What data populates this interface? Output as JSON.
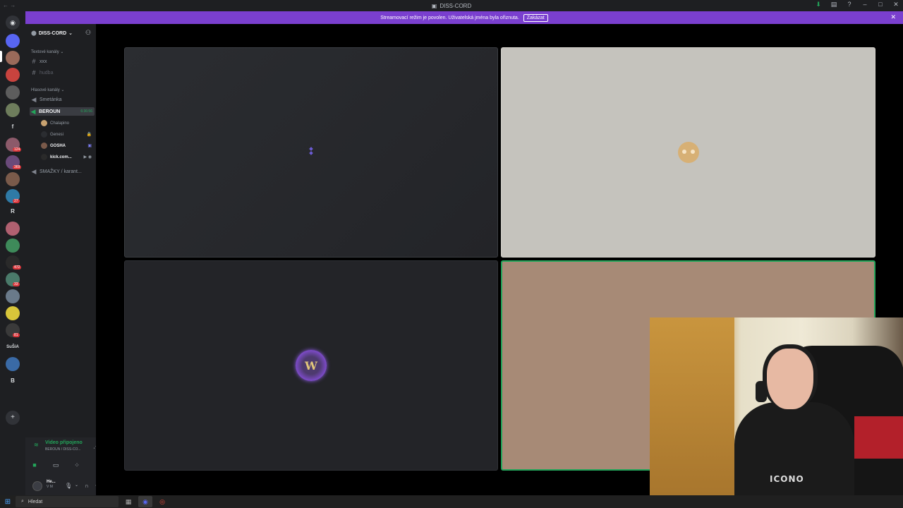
{
  "titlebar": {
    "title": "DISS-CORD"
  },
  "banner": {
    "text": "Streamovací režim je povolen. Uživatelská jména byla ořiznuta.",
    "button": "Zakázat"
  },
  "server_rail": {
    "letters": [
      "f",
      "R",
      "SuŠiA",
      "B"
    ],
    "badges": [
      "124",
      "369",
      "27",
      "472",
      "33",
      "81"
    ]
  },
  "guild": {
    "name": "DISS-CORD"
  },
  "categories": {
    "text": "Textové kanály",
    "voice": "Hlasové kanály"
  },
  "text_channels": [
    "xxx",
    "hudba"
  ],
  "voice_channels": {
    "smetanka": "Smetánka",
    "beroun": "BEROUN",
    "beroun_timer": "6:36:56",
    "smazky": "SMAŽKY / karant..."
  },
  "voice_users": [
    "Chalapino",
    "Genesi",
    "GOSHA",
    "kick.com..."
  ],
  "voice_panel": {
    "status": "Video připojeno",
    "sub": "BEROUN / DISS-CO..."
  },
  "user_panel": {
    "name": "He...",
    "sub": "V M"
  },
  "taskbar": {
    "search": "Hledat"
  },
  "colors": {
    "accent": "#7a3fcf",
    "online": "#23a55a",
    "speaking_border": "#23a55a"
  },
  "tiles": [
    {
      "name": "tile-1",
      "content": "loading-dots"
    },
    {
      "name": "tile-2",
      "content": "discord-avatar"
    },
    {
      "name": "tile-3",
      "content": "world-of-warcraft-avatar"
    },
    {
      "name": "tile-4",
      "content": "speaking-user"
    }
  ],
  "webcam": {
    "shirt_text": "ICONO"
  }
}
